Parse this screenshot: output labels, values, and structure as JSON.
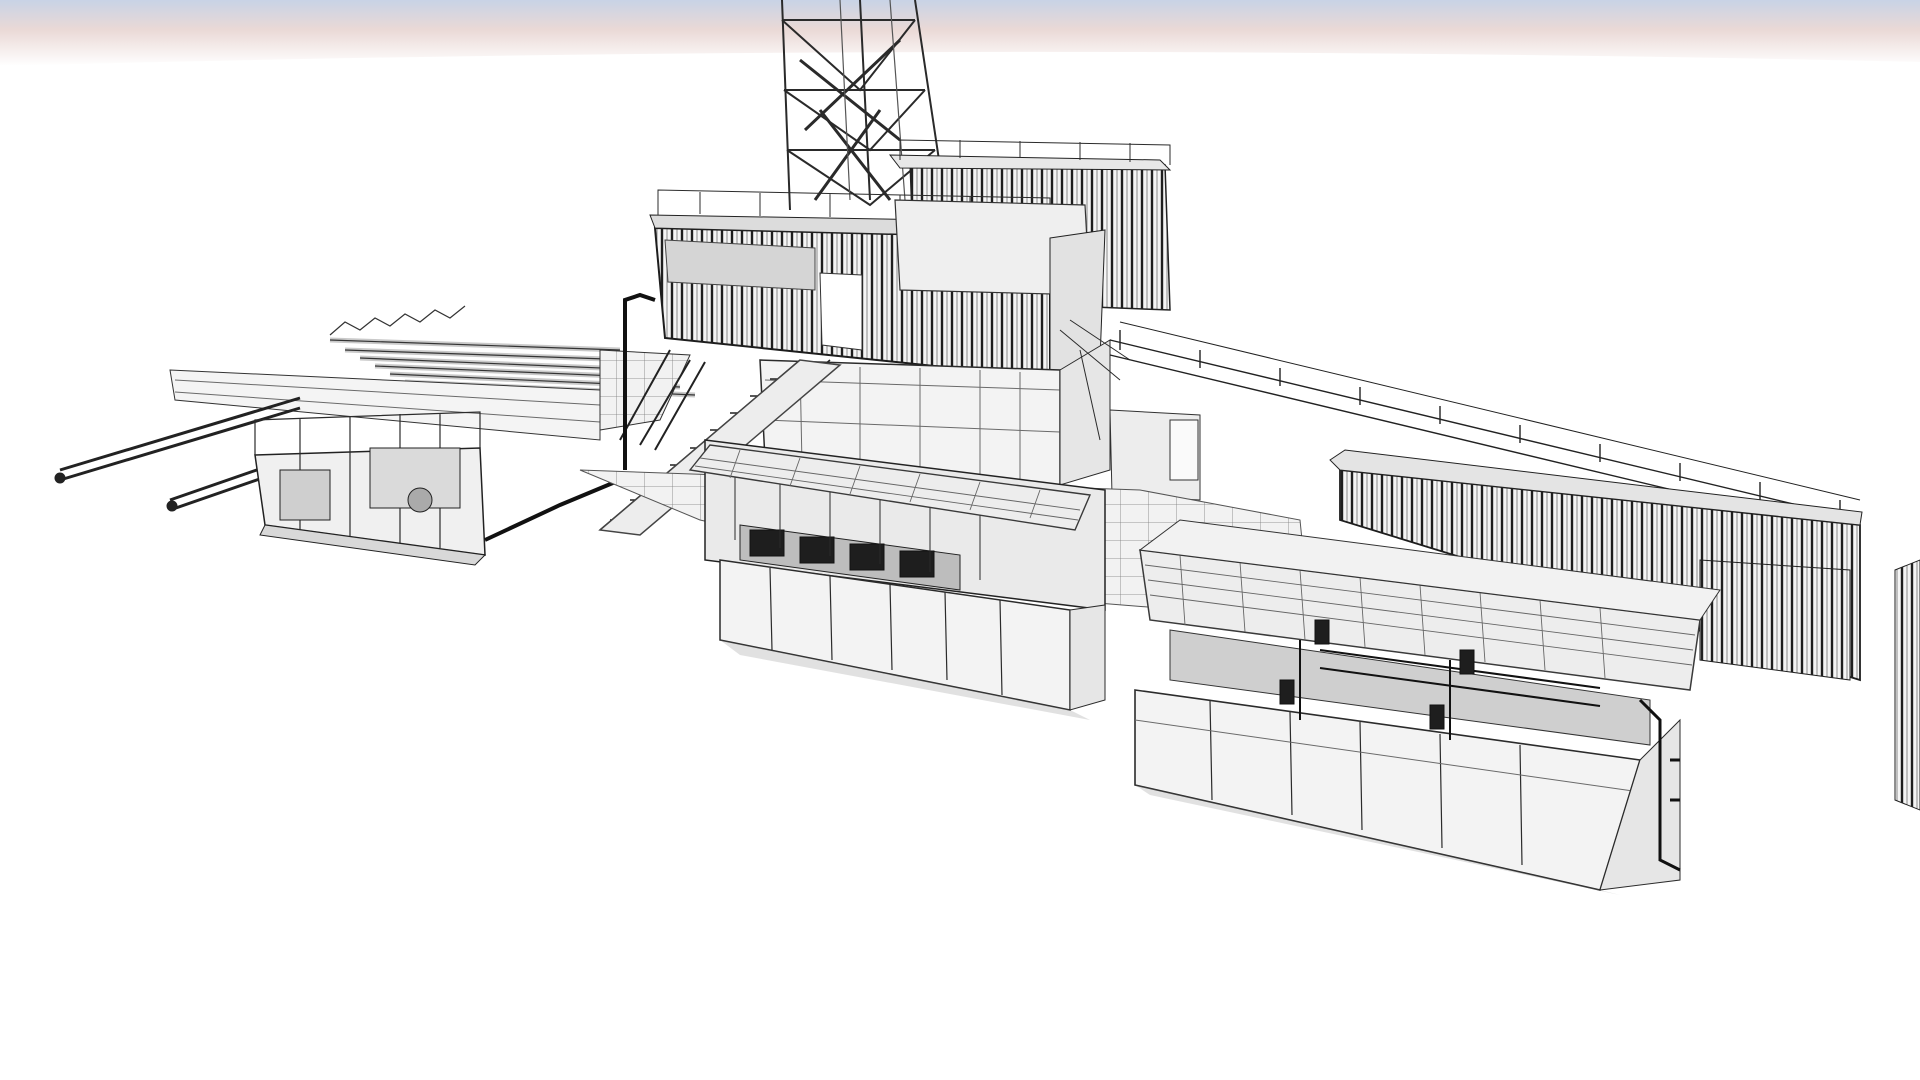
{
  "scene": {
    "background": "#ffffff",
    "sky_band_color": "#e8dede",
    "line_color": "#2b2b2b"
  }
}
